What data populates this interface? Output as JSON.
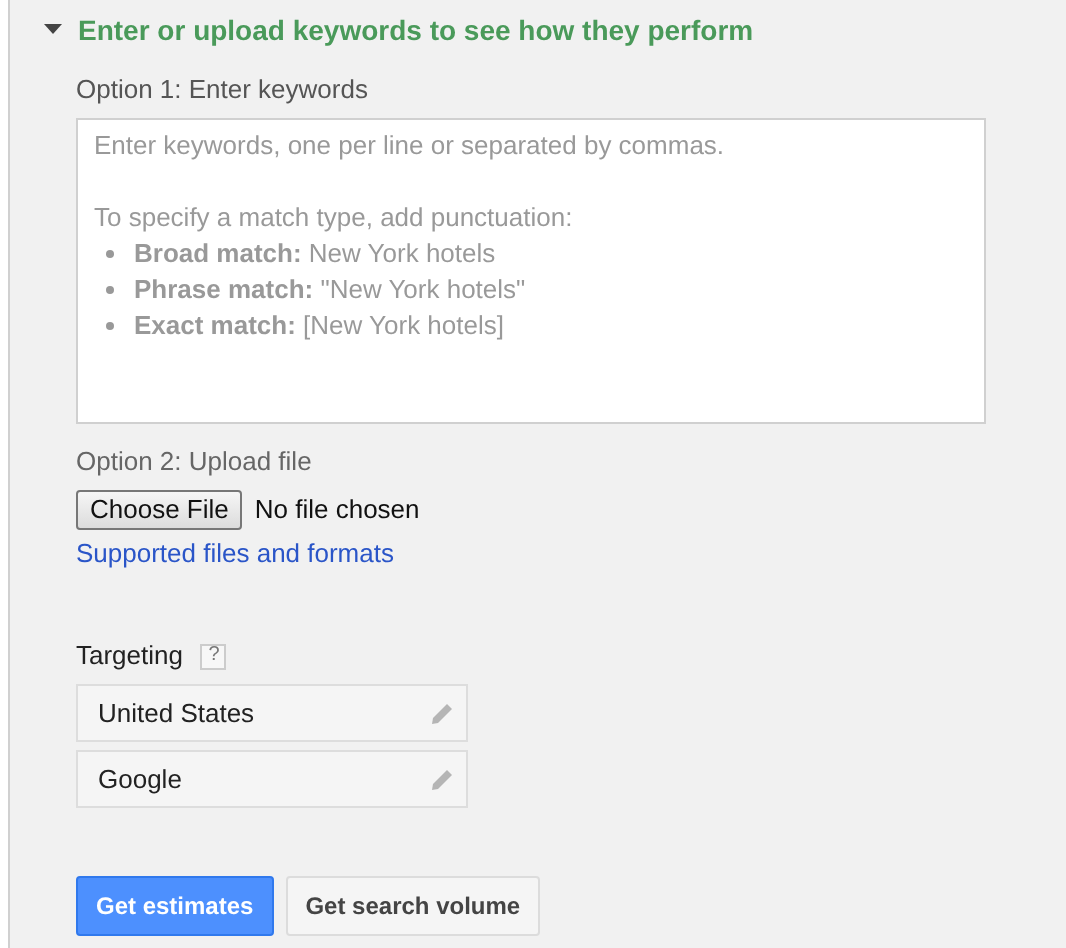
{
  "section": {
    "title": "Enter or upload keywords to see how they perform",
    "expanded": true
  },
  "option_1": {
    "label": "Option 1: Enter keywords",
    "keywords_field": {
      "placeholder": "Enter keywords, one per line or separated by commas.",
      "hint": "To specify a match type, add punctuation:",
      "examples": [
        {
          "text": "**Broad match:** New York hotels"
        },
        {
          "text": "**Phrase match:** \"New York hotels\""
        },
        {
          "text": "**Exact match:** [New York hotels]"
        }
      ]
    }
  },
  "option_2": {
    "label": "Option 2: Upload file",
    "file_button": "Choose File",
    "file_status": "No file chosen",
    "link": "Supported files and formats"
  },
  "targeting": {
    "label": "Targeting",
    "help": "?",
    "items": [
      {
        "value": "United States"
      },
      {
        "value": "Google"
      }
    ]
  },
  "buttons": [
    {
      "label": "Get estimates",
      "kind": "primary"
    },
    {
      "label": "Get search volume",
      "kind": "secondary"
    }
  ]
}
